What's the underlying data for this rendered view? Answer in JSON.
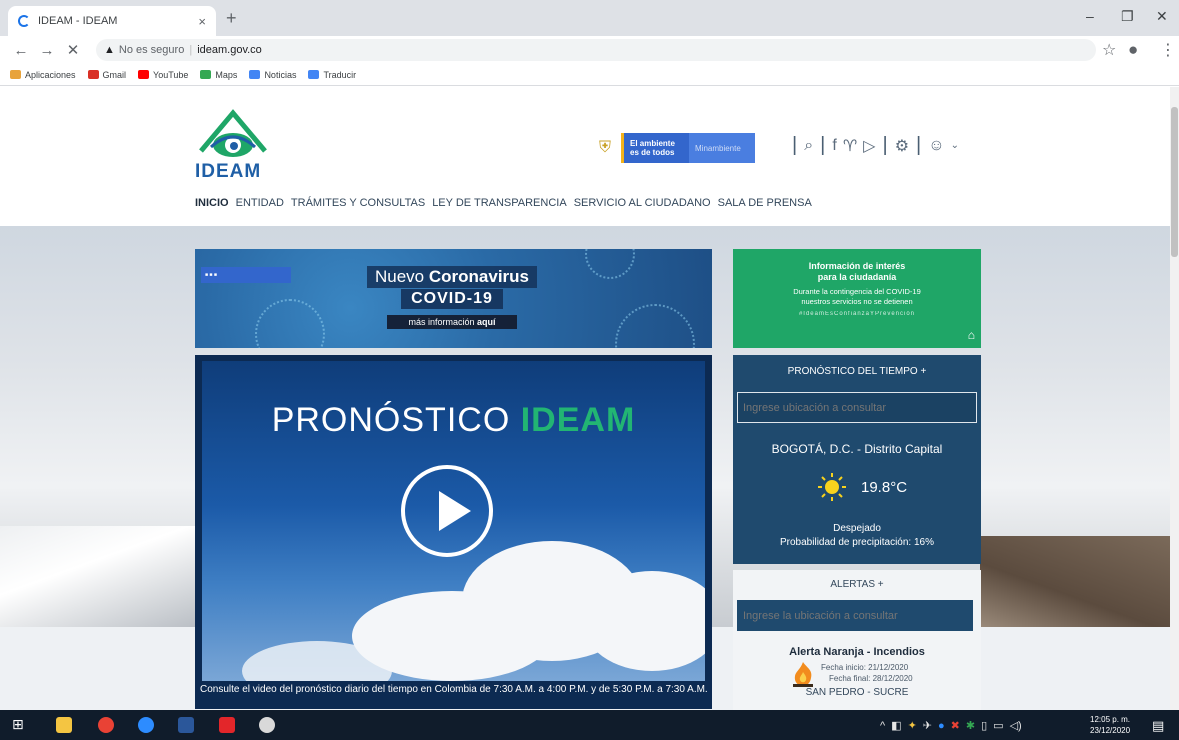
{
  "browser": {
    "tab_title": "IDEAM - IDEAM",
    "tab_close": "×",
    "new_tab": "+",
    "security_label": "No es seguro",
    "url": "ideam.gov.co",
    "back": "←",
    "forward": "→",
    "stop": "✕",
    "star": "☆",
    "menu": "⋮",
    "minimize": "–",
    "restore": "❐",
    "close": "✕",
    "bookmarks": [
      {
        "label": "Aplicaciones",
        "color": "#e8a33b"
      },
      {
        "label": "Gmail",
        "color": "#d93025"
      },
      {
        "label": "YouTube",
        "color": "#ff0000"
      },
      {
        "label": "Maps",
        "color": "#34a853"
      },
      {
        "label": "Noticias",
        "color": "#4285f4"
      },
      {
        "label": "Traducir",
        "color": "#4285f4"
      }
    ]
  },
  "header": {
    "logo_text": "IDEAM",
    "gov_line1": "El ambiente",
    "gov_line2": "es de todos",
    "gov_ministry": "Minambiente",
    "icons": [
      "search-icon",
      "facebook-icon",
      "twitter-icon",
      "youtube-icon",
      "accessibility-icon",
      "user-icon"
    ]
  },
  "nav": {
    "items": [
      "INICIO",
      "ENTIDAD",
      "TRÁMITES Y CONSULTAS",
      "LEY DE TRANSPARENCIA",
      "SERVICIO AL CIUDADANO",
      "SALA DE PRENSA"
    ]
  },
  "covid": {
    "line1_a": "Nuevo",
    "line1_b": "Coronavirus",
    "line2": "COVID-19",
    "line3_a": "más información",
    "line3_b": "aquí"
  },
  "info": {
    "title1": "Información de interés",
    "title2": "para la ciudadanía",
    "sub1": "Durante la contingencia del COVID-19",
    "sub2": "nuestros servicios no se detienen",
    "hashtag": "#IdeamEsConfianzaYPrevención"
  },
  "video": {
    "title_a": "PRONÓSTICO",
    "title_b": "IDEAM",
    "caption": "Consulte el video del pronóstico diario del tiempo en Colombia de 7:30 A.M. a 4:00 P.M. y de 5:30 P.M. a 7:30 A.M."
  },
  "forecast": {
    "title": "PRONÓSTICO DEL TIEMPO +",
    "placeholder": "Ingrese ubicación a consultar",
    "city": "BOGOTÁ, D.C. - Distrito Capital",
    "temp": "19.8°C",
    "condition": "Despejado",
    "probability": "Probabilidad de precipitación: 16%"
  },
  "alerts": {
    "title": "ALERTAS +",
    "placeholder": "Ingrese la ubicación a consultar",
    "name": "Alerta Naranja - Incendios",
    "start": "Fecha inicio: 21/12/2020",
    "end": "Fecha final: 28/12/2020",
    "place": "SAN PEDRO - SUCRE"
  },
  "taskbar": {
    "time": "12:05 p. m.",
    "date": "23/12/2020",
    "apps": [
      {
        "name": "windows",
        "color": "#ffffff"
      },
      {
        "name": "explorer",
        "color": "#f4c542"
      },
      {
        "name": "chrome",
        "color": "#e94235"
      },
      {
        "name": "zoom",
        "color": "#2d8cff"
      },
      {
        "name": "word",
        "color": "#2b579a"
      },
      {
        "name": "acrobat",
        "color": "#e3262a"
      },
      {
        "name": "paint",
        "color": "#d9d9d9"
      }
    ]
  },
  "colors": {
    "brand_green": "#1fa667",
    "brand_blue": "#1f5fa6",
    "panel_navy": "#1f4a6e"
  }
}
